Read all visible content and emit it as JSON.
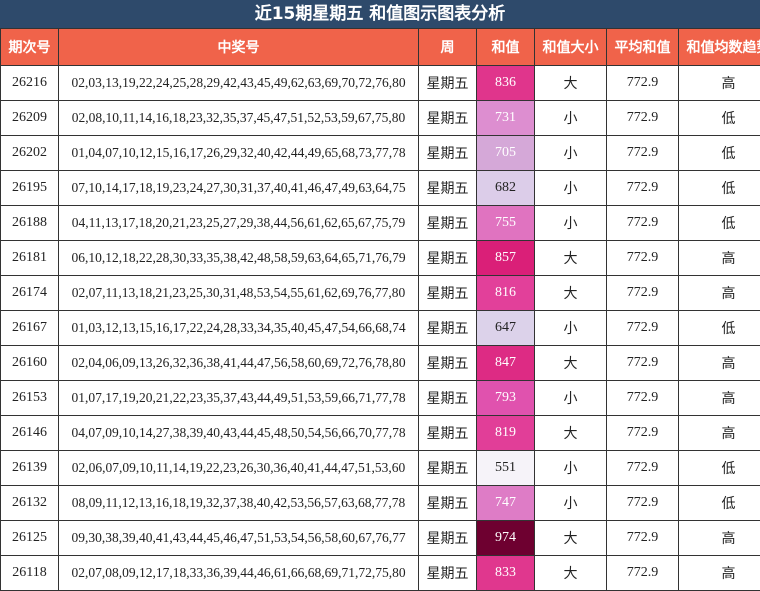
{
  "title": "近15期星期五 和值图示图表分析",
  "headers": [
    "期次号",
    "中奖号",
    "周",
    "和值",
    "和值大小",
    "平均和值",
    "和值均数趋势"
  ],
  "rows": [
    {
      "period": "26216",
      "numbers": "02,03,13,19,22,24,25,28,29,42,43,45,49,62,63,69,70,72,76,80",
      "weekday": "星期五",
      "sum": "836",
      "size": "大",
      "avg": "772.9",
      "trend": "高",
      "sum_color": "#e0358c"
    },
    {
      "period": "26209",
      "numbers": "02,08,10,11,14,16,18,23,32,35,37,45,47,51,52,53,59,67,75,80",
      "weekday": "星期五",
      "sum": "731",
      "size": "小",
      "avg": "772.9",
      "trend": "低",
      "sum_color": "#dd8ed0"
    },
    {
      "period": "26202",
      "numbers": "01,04,07,10,12,15,16,17,26,29,32,40,42,44,49,65,68,73,77,78",
      "weekday": "星期五",
      "sum": "705",
      "size": "小",
      "avg": "772.9",
      "trend": "低",
      "sum_color": "#d5a8d8"
    },
    {
      "period": "26195",
      "numbers": "07,10,14,17,18,19,23,24,27,30,31,37,40,41,46,47,49,63,64,75",
      "weekday": "星期五",
      "sum": "682",
      "size": "小",
      "avg": "772.9",
      "trend": "低",
      "sum_color": "#dccde9"
    },
    {
      "period": "26188",
      "numbers": "04,11,13,17,18,20,21,23,25,27,29,38,44,56,61,62,65,67,75,79",
      "weekday": "星期五",
      "sum": "755",
      "size": "小",
      "avg": "772.9",
      "trend": "低",
      "sum_color": "#e073c0"
    },
    {
      "period": "26181",
      "numbers": "06,10,12,18,22,28,30,33,35,38,42,48,58,59,63,64,65,71,76,79",
      "weekday": "星期五",
      "sum": "857",
      "size": "大",
      "avg": "772.9",
      "trend": "高",
      "sum_color": "#da1f78"
    },
    {
      "period": "26174",
      "numbers": "02,07,11,13,18,21,23,25,30,31,48,53,54,55,61,62,69,76,77,80",
      "weekday": "星期五",
      "sum": "816",
      "size": "大",
      "avg": "772.9",
      "trend": "高",
      "sum_color": "#e2409a"
    },
    {
      "period": "26167",
      "numbers": "01,03,12,13,15,16,17,22,24,28,33,34,35,40,45,47,54,66,68,74",
      "weekday": "星期五",
      "sum": "647",
      "size": "小",
      "avg": "772.9",
      "trend": "低",
      "sum_color": "#dcd2ea"
    },
    {
      "period": "26160",
      "numbers": "02,04,06,09,13,26,32,36,38,41,44,47,56,58,60,69,72,76,78,80",
      "weekday": "星期五",
      "sum": "847",
      "size": "大",
      "avg": "772.9",
      "trend": "高",
      "sum_color": "#dd2b84"
    },
    {
      "period": "26153",
      "numbers": "01,07,17,19,20,21,22,23,35,37,43,44,49,51,53,59,66,71,77,78",
      "weekday": "星期五",
      "sum": "793",
      "size": "小",
      "avg": "772.9",
      "trend": "高",
      "sum_color": "#e052ae"
    },
    {
      "period": "26146",
      "numbers": "04,07,09,10,14,27,38,39,40,43,44,45,48,50,54,56,66,70,77,78",
      "weekday": "星期五",
      "sum": "819",
      "size": "大",
      "avg": "772.9",
      "trend": "高",
      "sum_color": "#e13e98"
    },
    {
      "period": "26139",
      "numbers": "02,06,07,09,10,11,14,19,22,23,26,30,36,40,41,44,47,51,53,60",
      "weekday": "星期五",
      "sum": "551",
      "size": "小",
      "avg": "772.9",
      "trend": "低",
      "sum_color": "#f6f3f9"
    },
    {
      "period": "26132",
      "numbers": "08,09,11,12,13,16,18,19,32,37,38,40,42,53,56,57,63,68,77,78",
      "weekday": "星期五",
      "sum": "747",
      "size": "小",
      "avg": "772.9",
      "trend": "低",
      "sum_color": "#de7cc6"
    },
    {
      "period": "26125",
      "numbers": "09,30,38,39,40,41,43,44,45,46,47,51,53,54,56,58,60,67,76,77",
      "weekday": "星期五",
      "sum": "974",
      "size": "大",
      "avg": "772.9",
      "trend": "高",
      "sum_color": "#6e0030"
    },
    {
      "period": "26118",
      "numbers": "02,07,08,09,12,17,18,33,36,39,44,46,61,66,68,69,71,72,75,80",
      "weekday": "星期五",
      "sum": "833",
      "size": "大",
      "avg": "772.9",
      "trend": "高",
      "sum_color": "#e0378e"
    }
  ]
}
